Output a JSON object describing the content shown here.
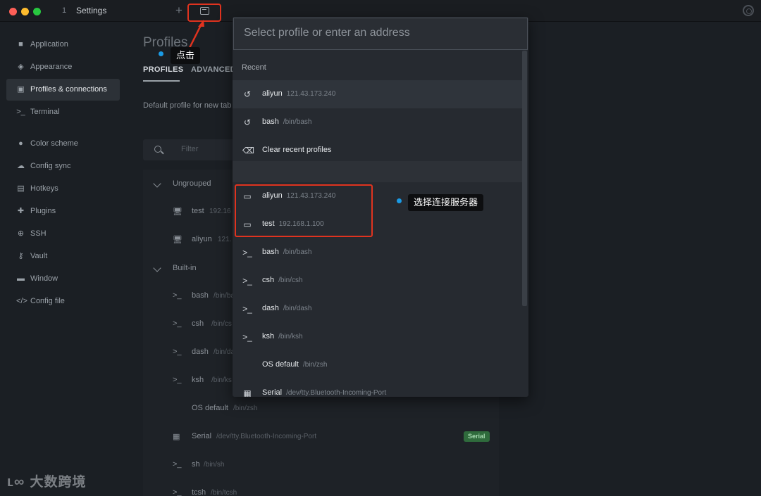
{
  "window": {
    "tab_number": "1",
    "tab_title": "Settings",
    "new_tab_label": "+"
  },
  "sidebar": {
    "items": [
      {
        "label": "Application",
        "icon": "square-icon"
      },
      {
        "label": "Appearance",
        "icon": "palette-icon"
      },
      {
        "label": "Profiles & connections",
        "icon": "window-icon"
      },
      {
        "label": "Terminal",
        "icon": "terminal-icon"
      },
      {
        "label": "Color scheme",
        "icon": "palette-icon"
      },
      {
        "label": "Config sync",
        "icon": "cloud-icon"
      },
      {
        "label": "Hotkeys",
        "icon": "keyboard-icon"
      },
      {
        "label": "Plugins",
        "icon": "puzzle-icon"
      },
      {
        "label": "SSH",
        "icon": "globe-icon"
      },
      {
        "label": "Vault",
        "icon": "key-icon"
      },
      {
        "label": "Window",
        "icon": "window-icon"
      },
      {
        "label": "Config file",
        "icon": "code-icon"
      }
    ]
  },
  "main": {
    "title": "Profiles",
    "tabs": [
      "PROFILES",
      "ADVANCED"
    ],
    "default_profile_text": "Default profile for new tab",
    "filter_placeholder": "Filter",
    "groups": [
      "Ungrouped",
      "Built-in"
    ],
    "ungrouped_profiles": [
      {
        "name": "test",
        "detail": "192.16"
      },
      {
        "name": "aliyun",
        "detail": "121."
      }
    ],
    "builtin_profiles": [
      {
        "name": "bash",
        "detail": "/bin/ba"
      },
      {
        "name": "csh",
        "detail": "/bin/cs"
      },
      {
        "name": "dash",
        "detail": "/bin/da"
      },
      {
        "name": "ksh",
        "detail": "/bin/ks"
      },
      {
        "name": "OS default",
        "detail": "/bin/zsh"
      },
      {
        "name": "Serial",
        "detail": "/dev/tty.Bluetooth-Incoming-Port"
      },
      {
        "name": "sh",
        "detail": "/bin/sh"
      },
      {
        "name": "tcsh",
        "detail": "/bin/tcsh"
      }
    ],
    "serial_badge": "Serial"
  },
  "dropdown": {
    "search_placeholder": "Select profile or enter an address",
    "section_recent": "Recent",
    "recent": [
      {
        "name": "aliyun",
        "detail": "121.43.173.240"
      },
      {
        "name": "bash",
        "detail": "/bin/bash"
      }
    ],
    "clear_label": "Clear recent profiles",
    "profiles": [
      {
        "name": "aliyun",
        "detail": "121.43.173.240"
      },
      {
        "name": "test",
        "detail": "192.168.1.100"
      },
      {
        "name": "bash",
        "detail": "/bin/bash"
      },
      {
        "name": "csh",
        "detail": "/bin/csh"
      },
      {
        "name": "dash",
        "detail": "/bin/dash"
      },
      {
        "name": "ksh",
        "detail": "/bin/ksh"
      },
      {
        "name": "OS default",
        "detail": "/bin/zsh"
      },
      {
        "name": "Serial",
        "detail": "/dev/tty.Bluetooth-Incoming-Port"
      }
    ]
  },
  "annotations": {
    "click": "点击",
    "select_server": "选择连接服务器"
  },
  "watermark": "大数跨境",
  "colors": {
    "accent_red": "#e0331f",
    "annotation_dot": "#1a9be6",
    "serial_badge": "#2f6b3c"
  }
}
